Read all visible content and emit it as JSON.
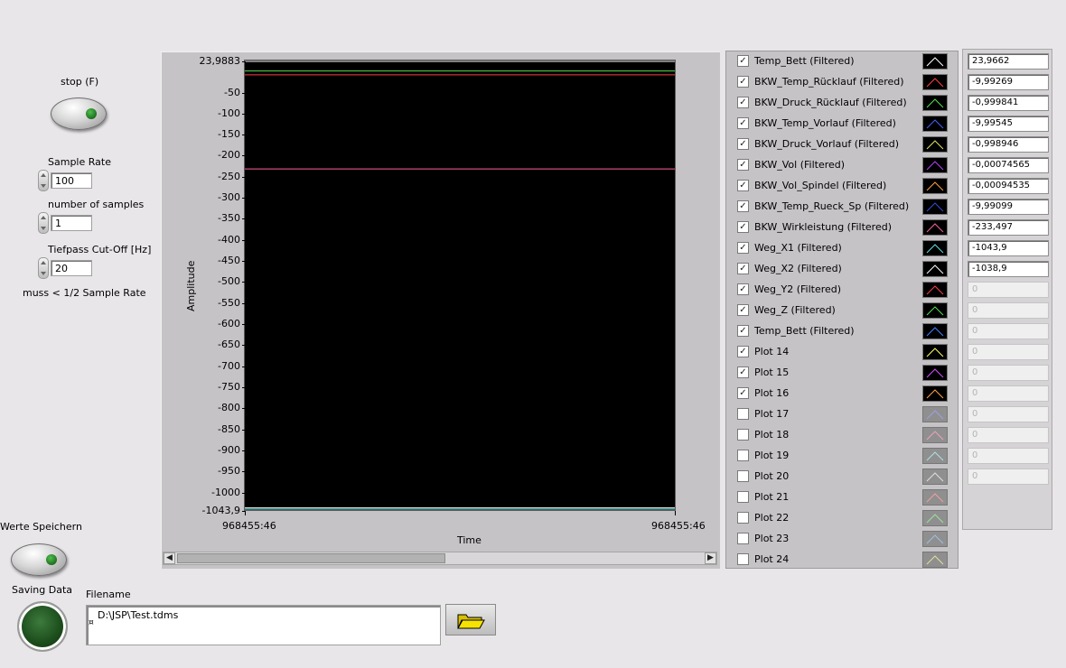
{
  "controls": {
    "stop_label": "stop (F)",
    "sample_rate_label": "Sample Rate",
    "sample_rate_value": "100",
    "num_samples_label": "number of samples",
    "num_samples_value": "1",
    "cutoff_label": "Tiefpass Cut-Off [Hz]",
    "cutoff_value": "20",
    "cutoff_note": "muss < 1/2 Sample Rate",
    "save_values_label": "Werte Speichern",
    "saving_data_label": "Saving Data",
    "filename_label": "Filename",
    "filename_value": "D:\\JSP\\Test.tdms",
    "path_icon": "¤"
  },
  "graph": {
    "ylabel": "Amplitude",
    "xlabel": "Time",
    "x_start": "968455:46",
    "x_end": "968455:46",
    "y_ticks": [
      "23,9883",
      "-50",
      "-100",
      "-150",
      "-200",
      "-250",
      "-300",
      "-350",
      "-400",
      "-450",
      "-500",
      "-550",
      "-600",
      "-650",
      "-700",
      "-750",
      "-800",
      "-850",
      "-900",
      "-950",
      "-1000",
      "-1043,9"
    ],
    "scroll_left": "◀",
    "scroll_right": "▶"
  },
  "chart_data": {
    "type": "line",
    "xlabel": "Time",
    "ylabel": "Amplitude",
    "ylim": [
      -1043.9,
      23.9883
    ],
    "x": [
      "968455:46",
      "968455:46"
    ],
    "series": [
      {
        "name": "Temp_Bett (Filtered)",
        "values": [
          23.9662,
          23.9662
        ],
        "color": "#ffffff"
      },
      {
        "name": "BKW_Temp_Rücklauf (Filtered)",
        "values": [
          -9.99269,
          -9.99269
        ],
        "color": "#ff4040"
      },
      {
        "name": "BKW_Druck_Rücklauf (Filtered)",
        "values": [
          -0.999841,
          -0.999841
        ],
        "color": "#50e050"
      },
      {
        "name": "BKW_Wirkleistung (Filtered)",
        "values": [
          -233.497,
          -233.497
        ],
        "color": "#ff60a0"
      },
      {
        "name": "Weg_X1 (Filtered)",
        "values": [
          -1043.9,
          -1043.9
        ],
        "color": "#60e0e0"
      },
      {
        "name": "Weg_X2 (Filtered)",
        "values": [
          -1038.9,
          -1038.9
        ],
        "color": "#ffffff"
      }
    ]
  },
  "legend": {
    "items": [
      {
        "name": "Temp_Bett (Filtered)",
        "checked": "✓",
        "value": "23,9662",
        "color": "#ffffff"
      },
      {
        "name": "BKW_Temp_Rücklauf (Filtered)",
        "checked": "✓",
        "value": "-9,99269",
        "color": "#ff4040"
      },
      {
        "name": "BKW_Druck_Rücklauf (Filtered)",
        "checked": "✓",
        "value": "-0,999841",
        "color": "#50e050"
      },
      {
        "name": "BKW_Temp_Vorlauf (Filtered)",
        "checked": "✓",
        "value": "-9,99545",
        "color": "#4060ff"
      },
      {
        "name": "BKW_Druck_Vorlauf (Filtered)",
        "checked": "✓",
        "value": "-0,998946",
        "color": "#e0e060"
      },
      {
        "name": "BKW_Vol (Filtered)",
        "checked": "✓",
        "value": "-0,00074565",
        "color": "#b040ff"
      },
      {
        "name": "BKW_Vol_Spindel (Filtered)",
        "checked": "✓",
        "value": "-0,00094535",
        "color": "#ffa040"
      },
      {
        "name": "BKW_Temp_Rueck_Sp (Filtered)",
        "checked": "✓",
        "value": "-9,99099",
        "color": "#3050d0"
      },
      {
        "name": "BKW_Wirkleistung (Filtered)",
        "checked": "✓",
        "value": "-233,497",
        "color": "#ff60a0"
      },
      {
        "name": "Weg_X1 (Filtered)",
        "checked": "✓",
        "value": "-1043,9",
        "color": "#60e0e0"
      },
      {
        "name": "Weg_X2 (Filtered)",
        "checked": "✓",
        "value": "-1038,9",
        "color": "#ffffff"
      },
      {
        "name": "Weg_Y2 (Filtered)",
        "checked": "✓",
        "value": "0",
        "color": "#ff4040"
      },
      {
        "name": "Weg_Z (Filtered)",
        "checked": "✓",
        "value": "0",
        "color": "#50e050"
      },
      {
        "name": "Temp_Bett (Filtered)",
        "checked": "✓",
        "value": "0",
        "color": "#4080ff"
      },
      {
        "name": "Plot 14",
        "checked": "✓",
        "value": "0",
        "color": "#ffff60"
      },
      {
        "name": "Plot 15",
        "checked": "✓",
        "value": "0",
        "color": "#d050ff"
      },
      {
        "name": "Plot 16",
        "checked": "✓",
        "value": "0",
        "color": "#ffa040"
      },
      {
        "name": "Plot 17",
        "checked": "",
        "value": "0",
        "color": "#a0a0e0"
      },
      {
        "name": "Plot 18",
        "checked": "",
        "value": "0",
        "color": "#f0a0c0"
      },
      {
        "name": "Plot 19",
        "checked": "",
        "value": "0",
        "color": "#b0e0e0"
      },
      {
        "name": "Plot 20",
        "checked": "",
        "value": "0",
        "color": "#e0e0e0"
      },
      {
        "name": "Plot 21",
        "checked": "",
        "value": "",
        "color": "#f0a0a0"
      },
      {
        "name": "Plot 22",
        "checked": "",
        "value": "",
        "color": "#a0e0a0"
      },
      {
        "name": "Plot 23",
        "checked": "",
        "value": "",
        "color": "#a0c0e0"
      },
      {
        "name": "Plot 24",
        "checked": "",
        "value": "",
        "color": "#e0e0a0"
      }
    ]
  }
}
